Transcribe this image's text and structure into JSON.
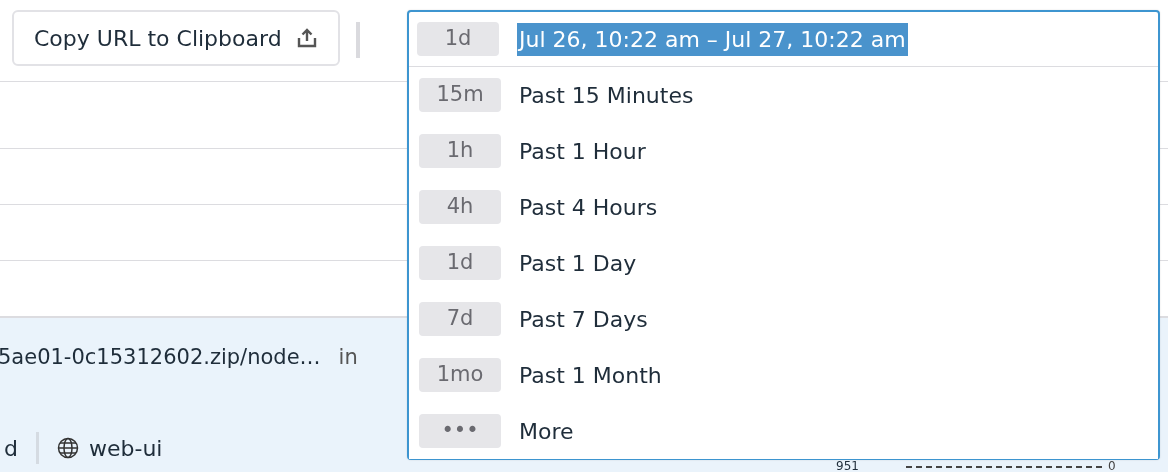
{
  "toolbar": {
    "copy_button": "Copy URL to Clipboard"
  },
  "background": {
    "row_text": "5ae01-0c15312602.zip/node…",
    "row_suffix": "in",
    "tag_fragment": "d",
    "service": "web-ui",
    "value": "951",
    "axis_value": "0"
  },
  "time_picker": {
    "input_chip": "1d",
    "input_value": "Jul 26, 10:22 am – Jul 27, 10:22 am",
    "options": [
      {
        "chip": "15m",
        "label": "Past 15 Minutes",
        "selected": false
      },
      {
        "chip": "1h",
        "label": "Past 1 Hour",
        "selected": false
      },
      {
        "chip": "4h",
        "label": "Past 4 Hours",
        "selected": false
      },
      {
        "chip": "1d",
        "label": "Past 1 Day",
        "selected": false
      },
      {
        "chip": "7d",
        "label": "Past 7 Days",
        "selected": false
      },
      {
        "chip": "1mo",
        "label": "Past 1 Month",
        "selected": false
      },
      {
        "chip": "•••",
        "label": "More",
        "selected": false
      }
    ]
  }
}
